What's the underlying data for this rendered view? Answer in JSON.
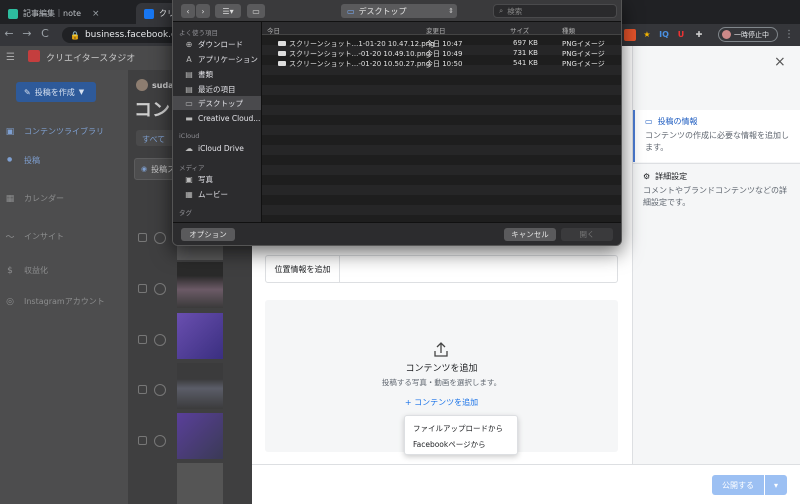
{
  "browser": {
    "tabs": [
      {
        "title": "記事編集｜note",
        "close": "×"
      },
      {
        "title": "クリエ"
      }
    ],
    "address": "business.facebook.com/cre",
    "nav": {
      "back": "←",
      "forward": "→",
      "reload": "C"
    },
    "extensions": [
      "IQ",
      "U"
    ],
    "profile_status": "一時停止中"
  },
  "fb": {
    "studio_title": "クリエイタースタジオ",
    "create_button": "投稿を作成",
    "sidebar": {
      "content_library": "コンテンツライブラリ",
      "posts": "投稿",
      "calendar": "カレンダー",
      "insights": "インサイト",
      "monetization": "収益化",
      "instagram": "Instagramアカウント"
    },
    "user_name": "suda",
    "page_heading": "コン",
    "tab_all": "すべて",
    "filter_label": "投稿ス"
  },
  "composer": {
    "close": "×",
    "right": {
      "post_info_title": "投稿の情報",
      "post_info_desc": "コンテンツの作成に必要な情報を追加します。",
      "details_title": "詳細設定",
      "details_desc": "コメントやブランドコンテンツなどの詳細設定です。"
    },
    "location_label": "位置情報を追加",
    "add_content_title": "コンテンツを追加",
    "add_content_sub": "投稿する写真・動画を選択します。",
    "add_content_link": "コンテンツを追加",
    "add_content_plus": "+",
    "menu": {
      "file_upload": "ファイルアップロードから",
      "facebook_page": "Facebookページから"
    },
    "publish": "公開する",
    "publish_dropdown": "▾"
  },
  "dialog": {
    "location": "デスクトップ",
    "search_placeholder": "検索",
    "sections": {
      "favorites": "よく使う項目",
      "icloud": "iCloud",
      "media": "メディア",
      "tags": "タグ"
    },
    "favorites": [
      "ダウンロード",
      "アプリケーション",
      "書類",
      "最近の項目",
      "デスクトップ",
      "Creative Cloud..."
    ],
    "icloud_items": [
      "iCloud Drive"
    ],
    "media_items": [
      "写真",
      "ムービー"
    ],
    "columns": {
      "name": "今日",
      "date": "変更日",
      "size": "サイズ",
      "kind": "種類"
    },
    "files": [
      {
        "name": "スクリーンショット...1-01-20 10.47.12.png",
        "date": "今日 10:47",
        "size": "697 KB",
        "kind": "PNGイメージ"
      },
      {
        "name": "スクリーンショット...-01-20 10.49.10.png",
        "date": "今日 10:49",
        "size": "731 KB",
        "kind": "PNGイメージ"
      },
      {
        "name": "スクリーンショット...-01-20 10.50.27.png",
        "date": "今日 10:50",
        "size": "541 KB",
        "kind": "PNGイメージ"
      }
    ],
    "options_button": "オプション",
    "cancel_button": "キャンセル",
    "open_button": "開く"
  },
  "colors": {
    "accent": "#1a73e8",
    "publish": "#9cc0f3",
    "active_border": "#4c7bd1"
  }
}
